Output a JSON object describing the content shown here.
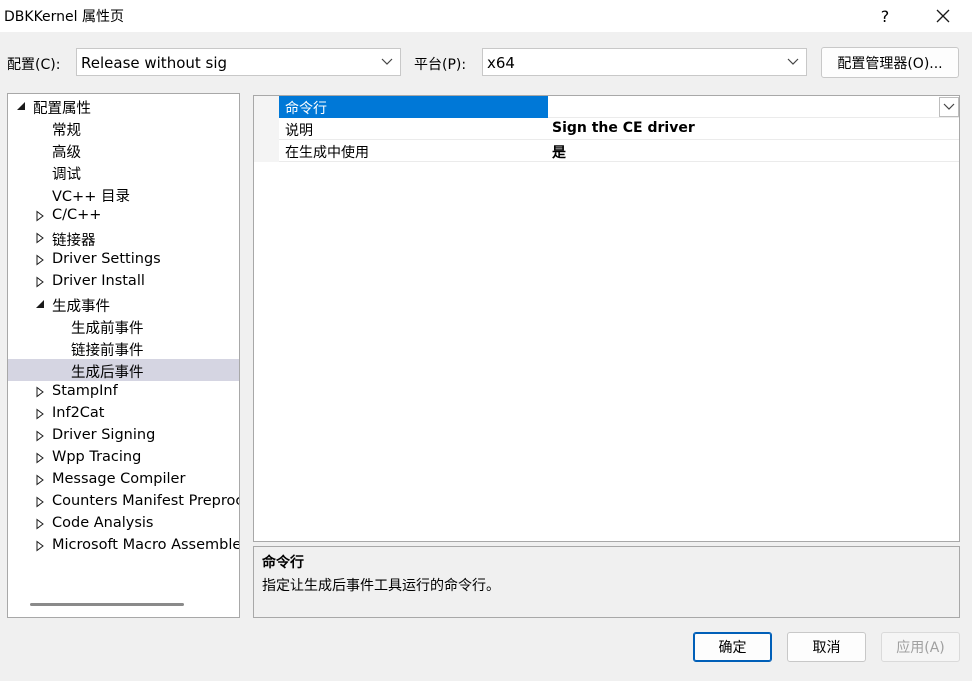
{
  "window": {
    "title": "DBKKernel 属性页",
    "help_label": "?",
    "close_label": "✕"
  },
  "config": {
    "config_label": "配置(C):",
    "config_value": "Release without sig",
    "platform_label": "平台(P):",
    "platform_value": "x64",
    "manager_label": "配置管理器(O)..."
  },
  "tree": {
    "items": [
      {
        "label": "配置属性",
        "expander": "expanded"
      },
      {
        "label": "常规",
        "expander": "none"
      },
      {
        "label": "高级",
        "expander": "none"
      },
      {
        "label": "调试",
        "expander": "none"
      },
      {
        "label": "VC++ 目录",
        "expander": "none"
      },
      {
        "label": "C/C++",
        "expander": "collapsed"
      },
      {
        "label": "链接器",
        "expander": "collapsed"
      },
      {
        "label": "Driver Settings",
        "expander": "collapsed"
      },
      {
        "label": "Driver Install",
        "expander": "collapsed"
      },
      {
        "label": "生成事件",
        "expander": "expanded"
      },
      {
        "label": "生成前事件",
        "expander": "none"
      },
      {
        "label": "链接前事件",
        "expander": "none"
      },
      {
        "label": "生成后事件",
        "expander": "none",
        "selected": true
      },
      {
        "label": "StampInf",
        "expander": "collapsed"
      },
      {
        "label": "Inf2Cat",
        "expander": "collapsed"
      },
      {
        "label": "Driver Signing",
        "expander": "collapsed"
      },
      {
        "label": "Wpp Tracing",
        "expander": "collapsed"
      },
      {
        "label": "Message Compiler",
        "expander": "collapsed"
      },
      {
        "label": "Counters Manifest Preprocessor",
        "expander": "collapsed"
      },
      {
        "label": "Code Analysis",
        "expander": "collapsed"
      },
      {
        "label": "Microsoft Macro Assembler",
        "expander": "collapsed"
      }
    ]
  },
  "grid": {
    "rows": [
      {
        "name": "命令行",
        "value": "",
        "selected": true,
        "has_dropdown": true
      },
      {
        "name": "说明",
        "value": "Sign the CE driver"
      },
      {
        "name": "在生成中使用",
        "value": "是"
      }
    ]
  },
  "description": {
    "title": "命令行",
    "text": "指定让生成后事件工具运行的命令行。"
  },
  "buttons": {
    "ok": "确定",
    "cancel": "取消",
    "apply": "应用(A)"
  },
  "colors": {
    "selection_blue": "#0078d7",
    "tree_selection": "#d5d5e2",
    "default_button_border": "#005fb8"
  }
}
